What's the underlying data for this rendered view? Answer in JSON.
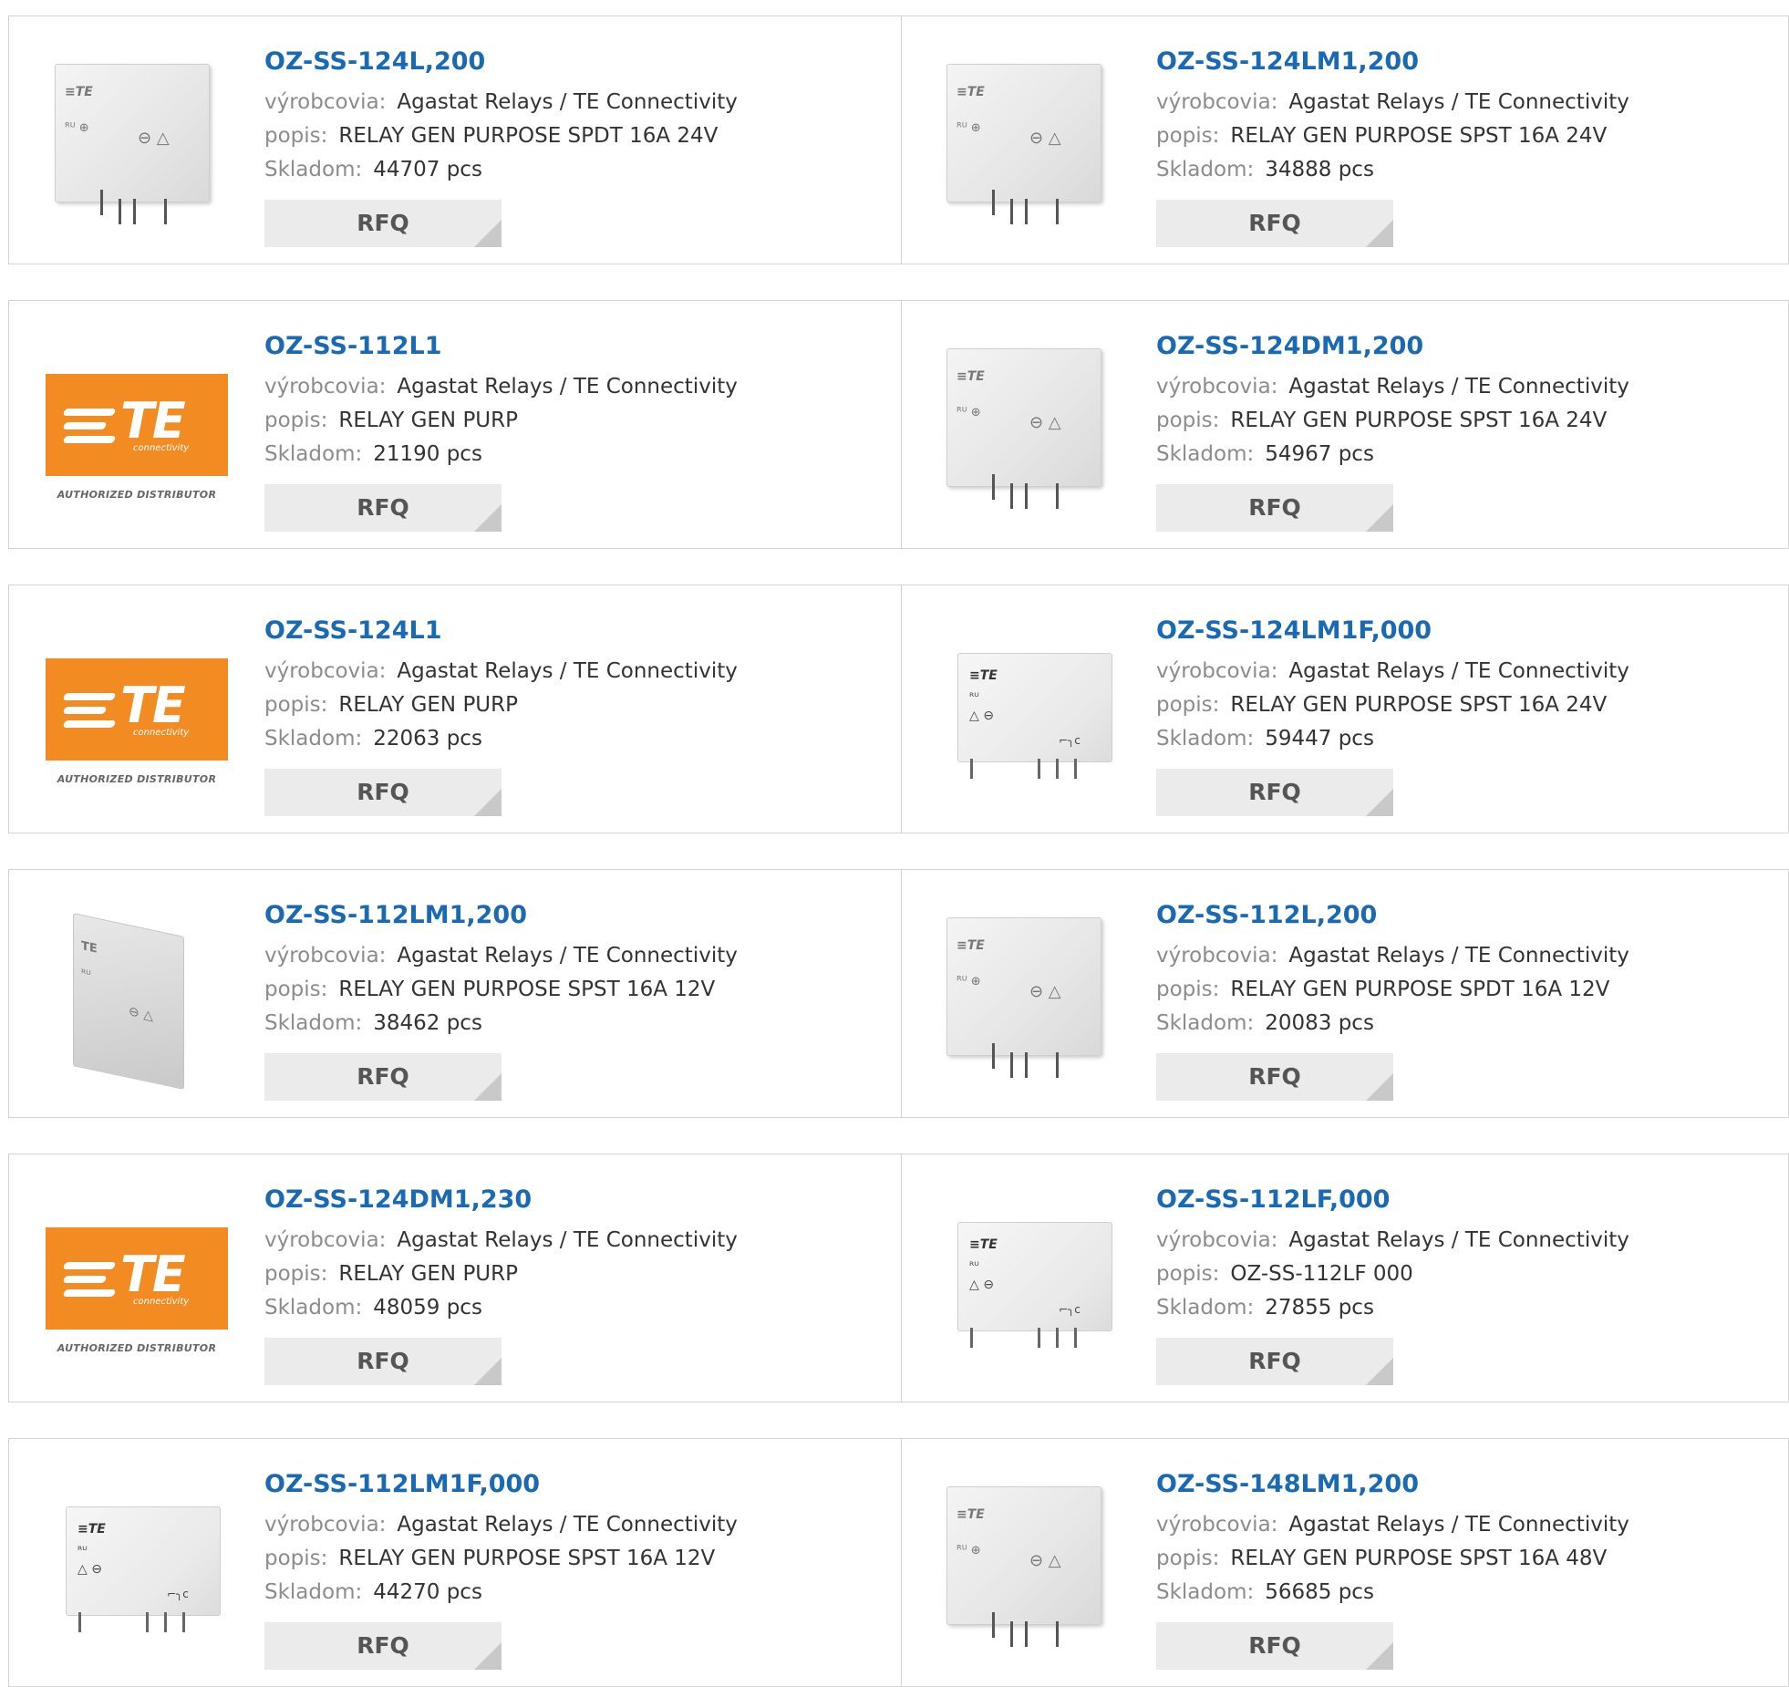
{
  "labels": {
    "manufacturer": "výrobcovia:",
    "description": "popis:",
    "stock": "Skladom:",
    "rfq": "RFQ"
  },
  "logo": {
    "te_text": "TE",
    "te_sub": "connectivity",
    "authorized": "AUTHORIZED DISTRIBUTOR"
  },
  "colors": {
    "link": "#1a6ab3",
    "te_orange": "#f28c22",
    "rfq_bg": "#ebebeb"
  },
  "products": [
    {
      "name": "OZ-SS-124L,200",
      "manufacturer": "Agastat Relays / TE Connectivity",
      "description": "RELAY GEN PURPOSE SPDT 16A 24V",
      "stock": "44707 pcs",
      "image": "relay-upright"
    },
    {
      "name": "OZ-SS-124LM1,200",
      "manufacturer": "Agastat Relays / TE Connectivity",
      "description": "RELAY GEN PURPOSE SPST 16A 24V",
      "stock": "34888 pcs",
      "image": "relay-upright"
    },
    {
      "name": "OZ-SS-112L1",
      "manufacturer": "Agastat Relays / TE Connectivity",
      "description": "RELAY GEN PURP",
      "stock": "21190 pcs",
      "image": "te-logo"
    },
    {
      "name": "OZ-SS-124DM1,200",
      "manufacturer": "Agastat Relays / TE Connectivity",
      "description": "RELAY GEN PURPOSE SPST 16A 24V",
      "stock": "54967 pcs",
      "image": "relay-upright"
    },
    {
      "name": "OZ-SS-124L1",
      "manufacturer": "Agastat Relays / TE Connectivity",
      "description": "RELAY GEN PURP",
      "stock": "22063 pcs",
      "image": "te-logo"
    },
    {
      "name": "OZ-SS-124LM1F,000",
      "manufacturer": "Agastat Relays / TE Connectivity",
      "description": "RELAY GEN PURPOSE SPST 16A 24V",
      "stock": "59447 pcs",
      "image": "relay-flat"
    },
    {
      "name": "OZ-SS-112LM1,200",
      "manufacturer": "Agastat Relays / TE Connectivity",
      "description": "RELAY GEN PURPOSE SPST 16A 12V",
      "stock": "38462 pcs",
      "image": "relay-angled"
    },
    {
      "name": "OZ-SS-112L,200",
      "manufacturer": "Agastat Relays / TE Connectivity",
      "description": "RELAY GEN PURPOSE SPDT 16A 12V",
      "stock": "20083 pcs",
      "image": "relay-upright"
    },
    {
      "name": "OZ-SS-124DM1,230",
      "manufacturer": "Agastat Relays / TE Connectivity",
      "description": "RELAY GEN PURP",
      "stock": "48059 pcs",
      "image": "te-logo"
    },
    {
      "name": "OZ-SS-112LF,000",
      "manufacturer": "Agastat Relays / TE Connectivity",
      "description": "OZ-SS-112LF 000",
      "stock": "27855 pcs",
      "image": "relay-flat"
    },
    {
      "name": "OZ-SS-112LM1F,000",
      "manufacturer": "Agastat Relays / TE Connectivity",
      "description": "RELAY GEN PURPOSE SPST 16A 12V",
      "stock": "44270 pcs",
      "image": "relay-flat"
    },
    {
      "name": "OZ-SS-148LM1,200",
      "manufacturer": "Agastat Relays / TE Connectivity",
      "description": "RELAY GEN PURPOSE SPST 16A 48V",
      "stock": "56685 pcs",
      "image": "relay-upright"
    }
  ]
}
